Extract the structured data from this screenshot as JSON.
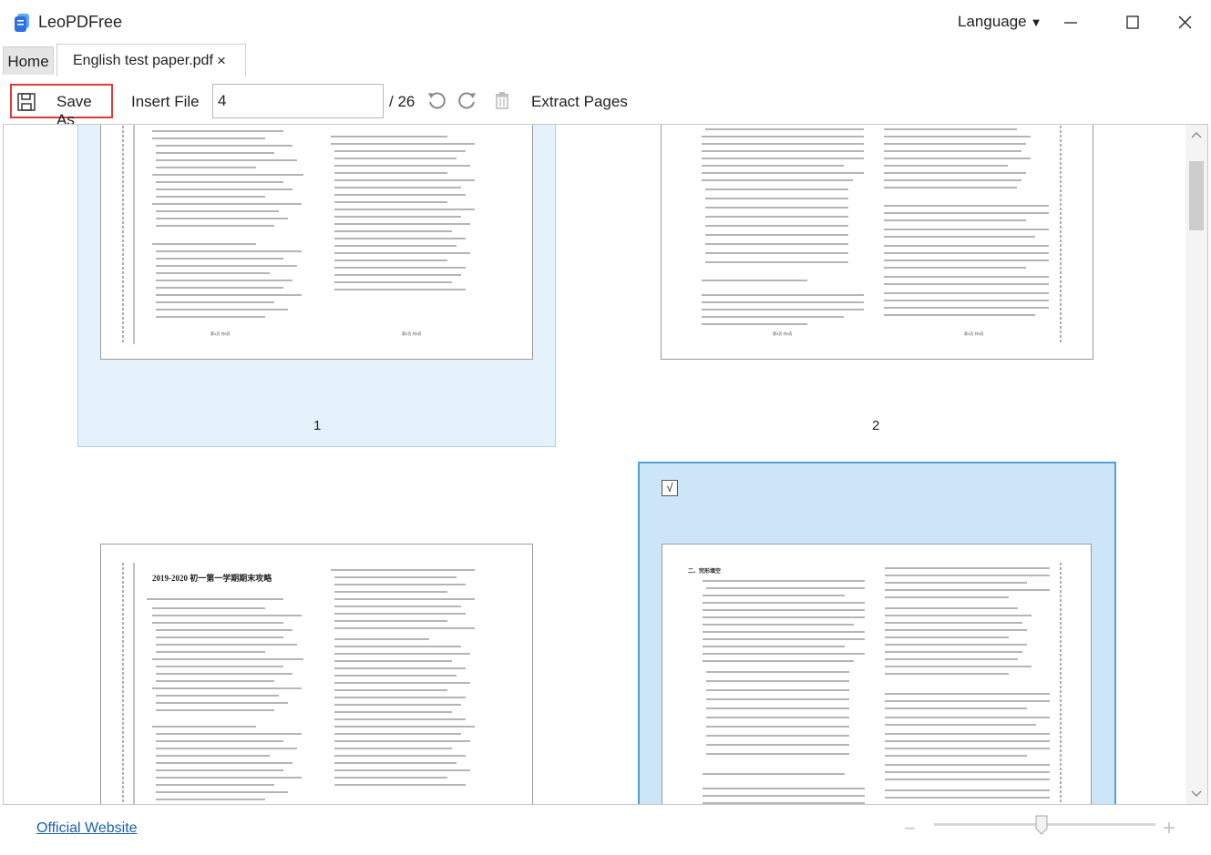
{
  "app": {
    "title": "LeoPDFree",
    "language_label": "Language",
    "language_caret": "▼"
  },
  "tabs": {
    "home": "Home",
    "file": "English test paper.pdf",
    "close": "×"
  },
  "toolbar": {
    "save_as": "Save As",
    "insert_file": "Insert File",
    "page_input_value": "4",
    "page_total": "/ 26",
    "extract_pages": "Extract Pages"
  },
  "pages": {
    "p1_label": "1",
    "p2_label": "2",
    "p4_checkmark": "√",
    "p1_footer_left": "第1页 共8页",
    "p1_footer_right": "第2页 共8页",
    "p2_footer_left": "第3页 共8页",
    "p2_footer_right": "第4页 共8页",
    "p3_title": "2019-2020 初一第一学期期末攻略",
    "p4_section": "二、完形填空"
  },
  "footer": {
    "official_website": "Official Website",
    "zoom_minus": "−",
    "zoom_plus": "+"
  },
  "zoom": {
    "level_fraction": 0.48
  },
  "colors": {
    "accent": "#49a3e0",
    "selection_fill": "#cde6f7",
    "highlight_border": "#e53935",
    "link": "#1a5fb4"
  },
  "icons": {
    "logo": "app-logo-icon",
    "save": "floppy-disk-icon",
    "undo": "rotate-left-icon",
    "redo": "rotate-right-icon",
    "delete": "trash-icon"
  }
}
